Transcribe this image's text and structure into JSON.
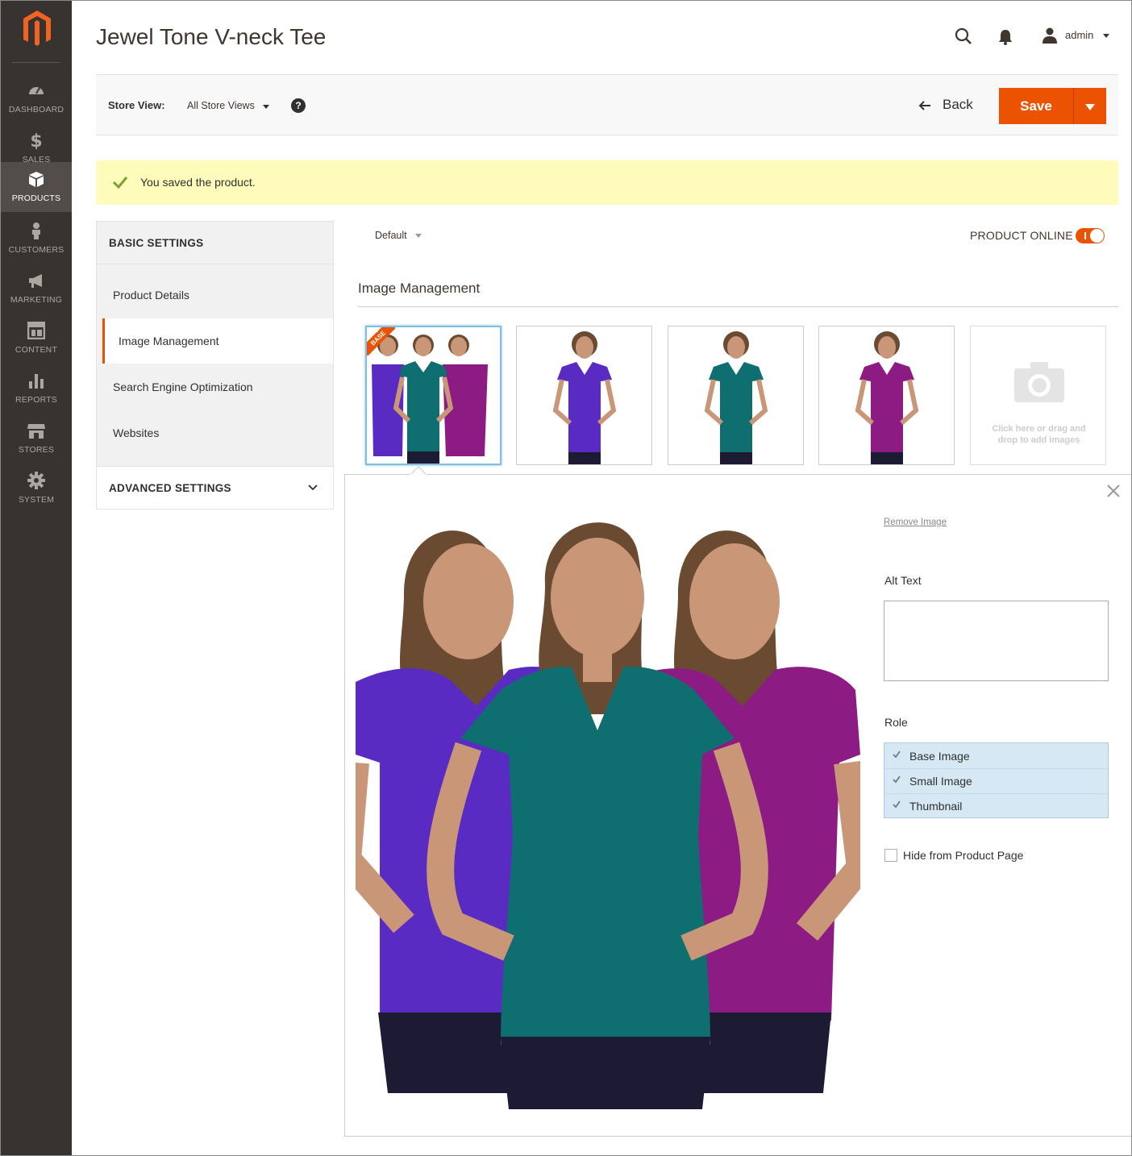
{
  "sidebar": {
    "logo": "magento-logo",
    "items": [
      {
        "label": "DASHBOARD",
        "icon": "dashboard-icon"
      },
      {
        "label": "SALES",
        "icon": "dollar-icon"
      },
      {
        "label": "PRODUCTS",
        "icon": "box-icon",
        "active": true
      },
      {
        "label": "CUSTOMERS",
        "icon": "person-icon"
      },
      {
        "label": "MARKETING",
        "icon": "megaphone-icon"
      },
      {
        "label": "CONTENT",
        "icon": "layout-icon"
      },
      {
        "label": "REPORTS",
        "icon": "bar-chart-icon"
      },
      {
        "label": "STORES",
        "icon": "storefront-icon"
      },
      {
        "label": "SYSTEM",
        "icon": "gear-icon"
      }
    ]
  },
  "header": {
    "title": "Jewel Tone V-neck Tee",
    "user_name": "admin"
  },
  "toolbar": {
    "store_view_label": "Store View:",
    "store_view_value": "All Store Views",
    "help": "?",
    "back_label": "Back",
    "save_label": "Save"
  },
  "message": {
    "text": "You saved the product."
  },
  "section_nav": {
    "basic_heading": "BASIC SETTINGS",
    "items": [
      "Product Details",
      "Image Management",
      "Search Engine Optimization",
      "Websites"
    ],
    "active_item": "Image Management",
    "advanced_heading": "ADVANCED SETTINGS"
  },
  "main": {
    "scope_value": "Default",
    "online_label": "PRODUCT ONLINE",
    "online_state": true,
    "section_title": "Image Management",
    "thumbnails": [
      {
        "shirts": [
          "#5a2bc2",
          "#0f6e70",
          "#8d1b84"
        ],
        "base": true,
        "badge": "BASE"
      },
      {
        "shirts": [
          "#5a2bc2"
        ],
        "base": false
      },
      {
        "shirts": [
          "#0f6e70"
        ],
        "base": false
      },
      {
        "shirts": [
          "#8d1b84"
        ],
        "base": false
      }
    ],
    "upload_text": "Click here or drag and drop to add images"
  },
  "detail": {
    "remove_label": "Remove Image",
    "alt_label": "Alt Text",
    "alt_value": "",
    "role_label": "Role",
    "roles": [
      "Base Image",
      "Small Image",
      "Thumbnail"
    ],
    "hide_label": "Hide from Product Page",
    "hide_checked": false
  },
  "colors": {
    "accent": "#eb5202",
    "sidebar_bg": "#373330",
    "message_bg": "#fffbbb",
    "role_bg": "#d6e8f3",
    "purple": "#5a2bc2",
    "teal": "#0f6e70",
    "magenta": "#8d1b84"
  }
}
